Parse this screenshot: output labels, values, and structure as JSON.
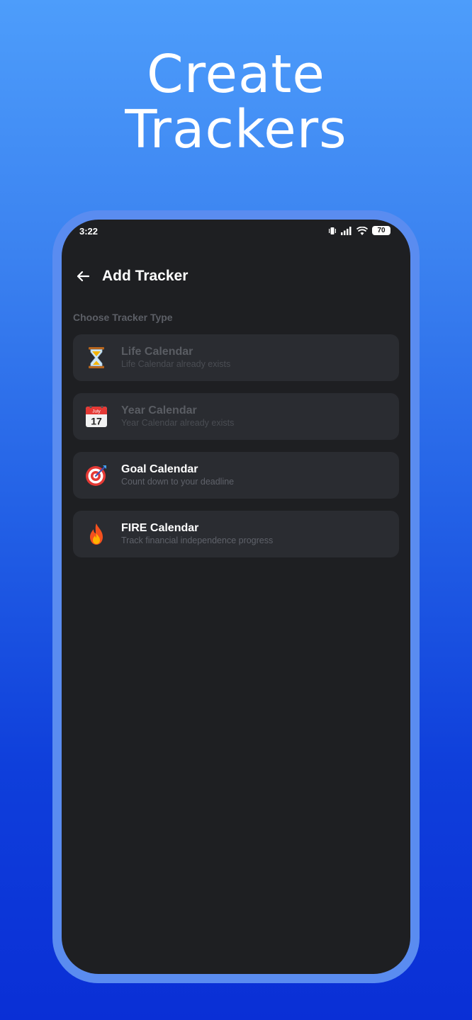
{
  "headline": {
    "line1": "Create",
    "line2": "Trackers"
  },
  "status_bar": {
    "time": "3:22",
    "battery": "70"
  },
  "appbar": {
    "title": "Add Tracker",
    "back_icon": "back-arrow-icon"
  },
  "section_label": "Choose Tracker Type",
  "trackers": [
    {
      "title": "Life Calendar",
      "subtitle": "Life Calendar already exists",
      "icon": "hourglass-icon",
      "enabled": false
    },
    {
      "title": "Year Calendar",
      "subtitle": "Year Calendar already exists",
      "icon": "calendar-icon",
      "enabled": false,
      "icon_month": "July",
      "icon_day": "17"
    },
    {
      "title": "Goal Calendar",
      "subtitle": "Count down to your deadline",
      "icon": "target-icon",
      "enabled": true
    },
    {
      "title": "FIRE Calendar",
      "subtitle": "Track financial independence progress",
      "icon": "fire-icon",
      "enabled": true
    }
  ],
  "colors": {
    "background_top": "#4d9dfb",
    "background_bottom": "#0a2fd6",
    "frame": "#5a8cf0",
    "screen": "#1e1f22",
    "card": "#2a2c31"
  }
}
